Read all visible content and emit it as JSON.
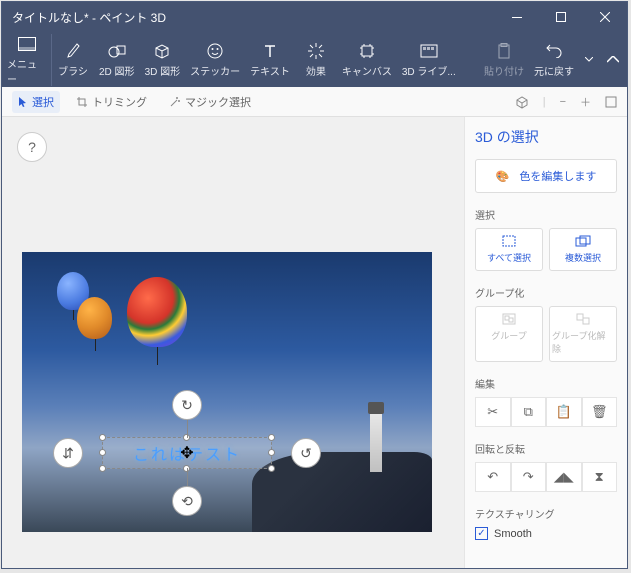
{
  "titlebar": {
    "title": "タイトルなし* - ペイント 3D"
  },
  "ribbon": {
    "menu": "メニュー",
    "items": [
      {
        "label": "ブラシ"
      },
      {
        "label": "2D 図形"
      },
      {
        "label": "3D 図形"
      },
      {
        "label": "ステッカー"
      },
      {
        "label": "テキスト"
      },
      {
        "label": "効果"
      },
      {
        "label": "キャンバス"
      },
      {
        "label": "3D ライブ..."
      }
    ],
    "paste": "貼り付け",
    "undo": "元に戻す"
  },
  "secondbar": {
    "select": "選択",
    "trimming": "トリミング",
    "magic": "マジック選択"
  },
  "canvas": {
    "text_content": "これはテスト"
  },
  "sidepanel": {
    "title": "3D の選択",
    "edit_colors": "色を編集します",
    "sections": {
      "select": "選択",
      "select_all": "すべて選択",
      "multi_select": "複数選択",
      "group": "グループ化",
      "group_btn": "グループ",
      "ungroup_btn": "グループ化解除",
      "edit": "編集",
      "rotate": "回転と反転",
      "texturing": "テクスチャリング",
      "smooth": "Smooth"
    }
  }
}
